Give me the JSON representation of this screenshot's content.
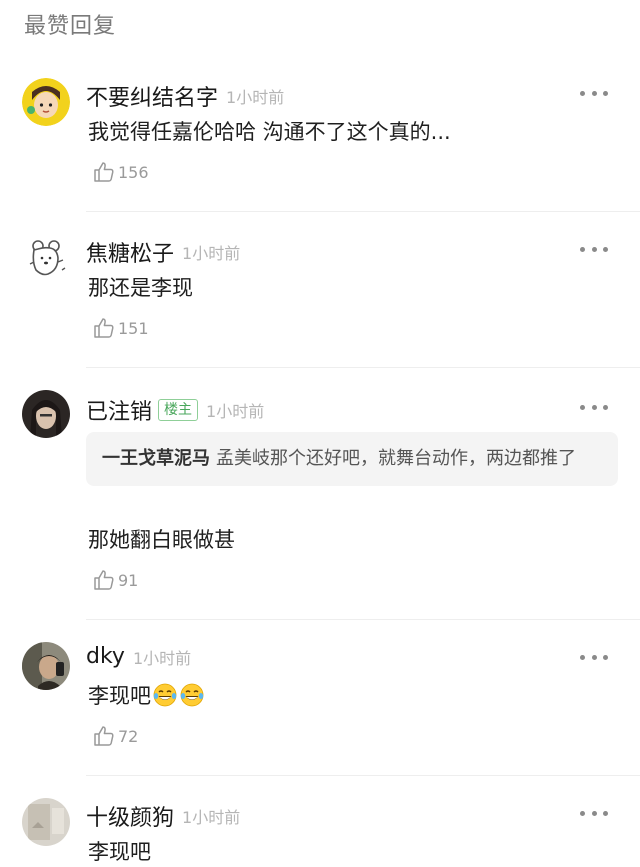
{
  "section": {
    "title": "最赞回复"
  },
  "comments": [
    {
      "username": "不要纠结名字",
      "time": "1小时前",
      "text": "我觉得任嘉伦哈哈  沟通不了这个真的...",
      "likes": "156",
      "avatar_icon": "cartoon-face-avatar"
    },
    {
      "username": "焦糖松子",
      "time": "1小时前",
      "text": "那还是李现",
      "likes": "151",
      "avatar_icon": "sketch-bear-avatar"
    },
    {
      "username": "已注销",
      "badge": "楼主",
      "time": "1小时前",
      "quote": {
        "name": "一王戈草泥马",
        "text": "孟美岐那个还好吧，就舞台动作，两边都推了"
      },
      "text": "那她翻白眼做甚",
      "likes": "91",
      "avatar_icon": "photo-avatar"
    },
    {
      "username": "dky",
      "time": "1小时前",
      "text": "李现吧",
      "emoji": [
        "joy-tears-emoji",
        "joy-tears-emoji"
      ],
      "likes": "72",
      "avatar_icon": "photo-avatar"
    },
    {
      "username": "十级颜狗",
      "time": "1小时前",
      "text": "李现吧",
      "avatar_icon": "photo-avatar"
    }
  ],
  "colors": {
    "text": "#1a1a1a",
    "muted": "#b5b5b5",
    "badge": "#4aa75c",
    "quote_bg": "#f4f4f4",
    "divider": "#eeeeee"
  },
  "icons": {
    "like": "thumbs-up-icon",
    "more": "more-dots-icon"
  }
}
